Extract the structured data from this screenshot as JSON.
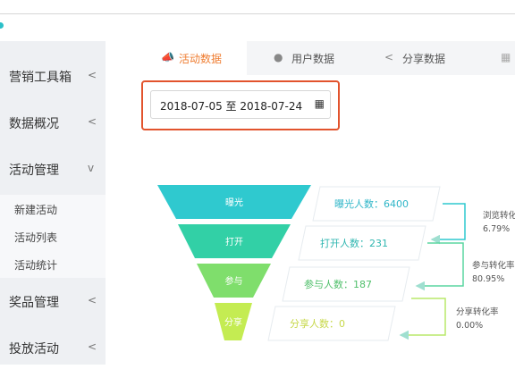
{
  "sidebar": {
    "items": [
      {
        "label": "营销工具箱",
        "arrow": "<"
      },
      {
        "label": "数据概况",
        "arrow": "<"
      },
      {
        "label": "活动管理",
        "arrow": "v"
      },
      {
        "label": "奖品管理",
        "arrow": "<"
      },
      {
        "label": "投放活动",
        "arrow": "<"
      }
    ],
    "subitems": [
      "新建活动",
      "活动列表",
      "活动统计"
    ]
  },
  "tabs": [
    {
      "label": "活动数据",
      "icon": "megaphone-icon",
      "active": true
    },
    {
      "label": "用户数据",
      "icon": "user-icon",
      "active": false
    },
    {
      "label": "分享数据",
      "icon": "share-icon",
      "active": false
    }
  ],
  "date_range": {
    "value": "2018-07-05 至 2018-07-24",
    "icon": "calendar-icon"
  },
  "funnel": {
    "stages": [
      {
        "name": "曝光",
        "label": "曝光人数：6400",
        "color": "#2fc9cf"
      },
      {
        "name": "打开",
        "label": "打开人数：231",
        "color": "#32d0a6"
      },
      {
        "name": "参与",
        "label": "参与人数：187",
        "color": "#7fde6c"
      },
      {
        "name": "分享",
        "label": "分享人数：0",
        "color": "#c4ec52"
      }
    ],
    "conversions": [
      {
        "label": "浏览转化",
        "value": "6.79%"
      },
      {
        "label": "参与转化率",
        "value": "80.95%"
      },
      {
        "label": "分享转化率",
        "value": "0.00%"
      }
    ]
  },
  "colors": {
    "accent": "#ef7c30",
    "highlight": "#e2532d",
    "teal": "#2fc9cf"
  }
}
